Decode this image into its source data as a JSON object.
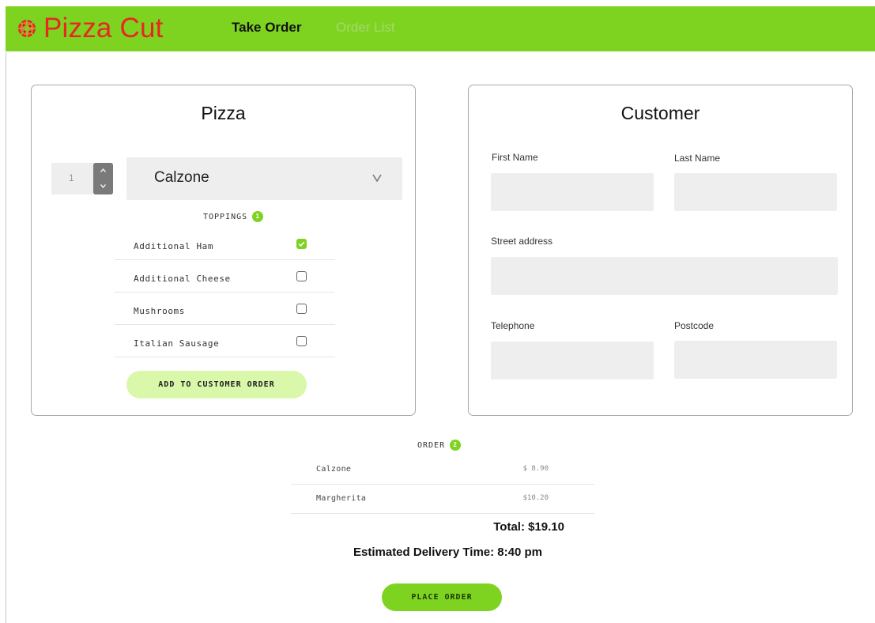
{
  "header": {
    "brand": "Pizza Cut",
    "brand_icon": "pizza-icon",
    "nav": {
      "take_order": "Take Order",
      "order_list": "Order List"
    },
    "colors": {
      "bar": "#7ed321",
      "brand": "#e8271f",
      "inactive_nav": "#a6d86a"
    }
  },
  "pizza": {
    "title": "Pizza",
    "quantity": "1",
    "selected_pizza": "Calzone",
    "toppings_label": "TOPPINGS",
    "toppings_count": "1",
    "toppings": [
      {
        "name": "Additional Ham",
        "checked": true
      },
      {
        "name": "Additional Cheese",
        "checked": false
      },
      {
        "name": "Mushrooms",
        "checked": false
      },
      {
        "name": "Italian Sausage",
        "checked": false
      }
    ],
    "add_button": "ADD TO CUSTOMER ORDER"
  },
  "customer": {
    "title": "Customer",
    "first_name": {
      "label": "First Name",
      "value": ""
    },
    "last_name": {
      "label": "Last Name",
      "value": ""
    },
    "street": {
      "label": "Street address",
      "value": ""
    },
    "telephone": {
      "label": "Telephone",
      "value": ""
    },
    "postcode": {
      "label": "Postcode",
      "value": ""
    }
  },
  "order": {
    "label": "ORDER",
    "count": "2",
    "items": [
      {
        "name": "Calzone",
        "price": "$ 8.90"
      },
      {
        "name": "Margherita",
        "price": "$10.20"
      }
    ],
    "total": "Total: $19.10",
    "eta": "Estimated Delivery Time: 8:40 pm",
    "place_button": "PLACE ORDER"
  }
}
